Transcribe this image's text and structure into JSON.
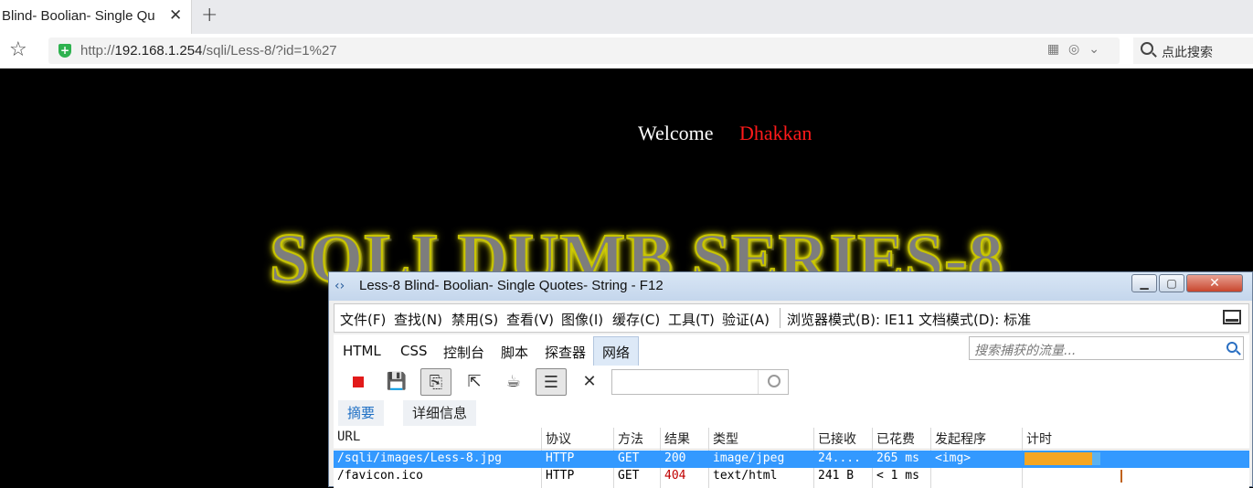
{
  "browser": {
    "tab_title": "Blind- Boolian- Single Qu",
    "tab_close": "✕",
    "new_tab": "+",
    "url_prefix": "http://",
    "url_host": "192.168.1.254",
    "url_path": "/sqli/Less-8/?id=1%27",
    "search_placeholder": "点此搜索"
  },
  "page": {
    "welcome": "Welcome",
    "name": "Dhakkan",
    "banner": "SQLI DUMB SERIES-8"
  },
  "devtools": {
    "title": "Less-8 Blind- Boolian- Single Quotes- String - F12",
    "menu": [
      "文件(F)",
      "查找(N)",
      "禁用(S)",
      "查看(V)",
      "图像(I)",
      "缓存(C)",
      "工具(T)",
      "验证(A)",
      "浏览器模式(B): IE11",
      "文档模式(D): 标准"
    ],
    "tabs": [
      "HTML",
      "CSS",
      "控制台",
      "脚本",
      "探查器",
      "网络"
    ],
    "active_tab": "网络",
    "traffic_search_placeholder": "搜索捕获的流量...",
    "subtabs": [
      "摘要",
      "详细信息"
    ],
    "columns": [
      "URL",
      "协议",
      "方法",
      "结果",
      "类型",
      "已接收",
      "已花费",
      "发起程序",
      "计时"
    ],
    "rows": [
      {
        "url": "/sqli/images/Less-8.jpg",
        "protocol": "HTTP",
        "method": "GET",
        "result": "200",
        "type": "image/jpeg",
        "received": "24....",
        "taken": "265 ms",
        "initiator": "<img>"
      },
      {
        "url": "/favicon.ico",
        "protocol": "HTTP",
        "method": "GET",
        "result": "404",
        "type": "text/html",
        "received": "241 B",
        "taken": "< 1 ms",
        "initiator": ""
      }
    ]
  },
  "colors": {
    "selected_row": "#3399ff",
    "timing_wait": "#f5a623",
    "timing_receive": "#5bb2f0",
    "error_result": "#c00000"
  }
}
